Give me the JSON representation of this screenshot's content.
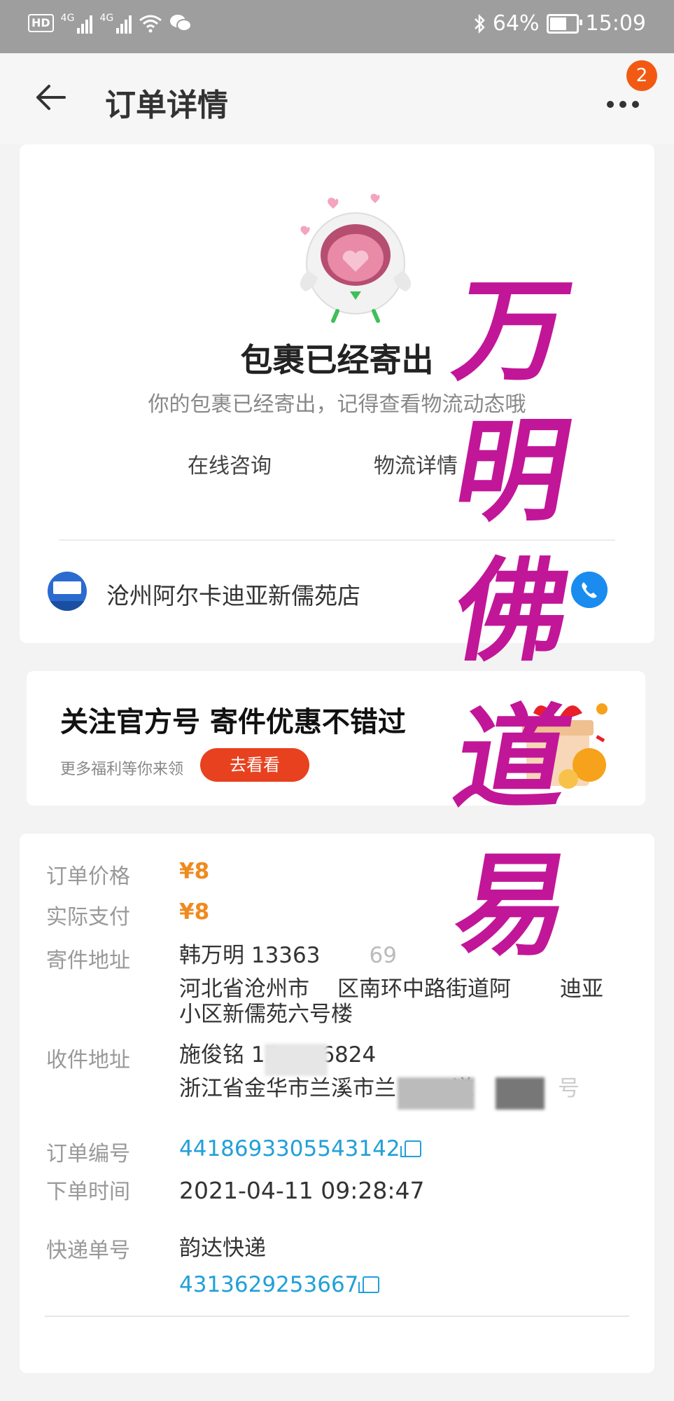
{
  "status_bar": {
    "left_indicators": [
      "HD",
      "4G",
      "4G",
      "wifi-icon",
      "wechat-icon"
    ],
    "battery": "64%",
    "time": "15:09"
  },
  "header": {
    "title": "订单详情",
    "more_badge": "2"
  },
  "shipment": {
    "status_title": "包裹已经寄出",
    "status_subtitle": "你的包裹已经寄出，记得查看物流动态哦",
    "actions": [
      "在线咨询",
      "物流详情"
    ],
    "shop_name": "沧州阿尔卡迪亚新儒苑店"
  },
  "promo": {
    "title": "关注官方号 寄件优惠不错过",
    "subtitle": "更多福利等你来领",
    "button": "去看看"
  },
  "order": {
    "price_label": "订单价格",
    "price_value": "¥8",
    "paid_label": "实际支付",
    "paid_value": "¥8",
    "sender_label": "寄件地址",
    "sender_name_phone": "韩万明 13363",
    "sender_phone_tail": "69",
    "sender_address_a": "河北省沧州市",
    "sender_address_b": "区南环中路街道阿",
    "sender_address_c": "迪亚",
    "sender_address_line2": "小区新儒苑六号楼",
    "receiver_label": "收件地址",
    "receiver_name": "施俊铭 15",
    "receiver_phone_tail": "6824",
    "receiver_address_a": "浙江省金华市兰溪市兰",
    "receiver_address_b": "道",
    "receiver_address_c": "号",
    "order_no_label": "订单编号",
    "order_no": "4418693305543142",
    "time_label": "下单时间",
    "time_value": "2021-04-11 09:28:47",
    "express_label": "快递单号",
    "express_company": "韵达快递",
    "express_no": "4313629253667"
  },
  "watermark": [
    "万",
    "明",
    "佛",
    "道",
    "易"
  ],
  "colors": {
    "accent_orange": "#f08a1e",
    "link_blue": "#22a0d8",
    "promo_red": "#e8411f",
    "watermark_magenta": "#c21698",
    "badge_orange": "#f25a14"
  }
}
